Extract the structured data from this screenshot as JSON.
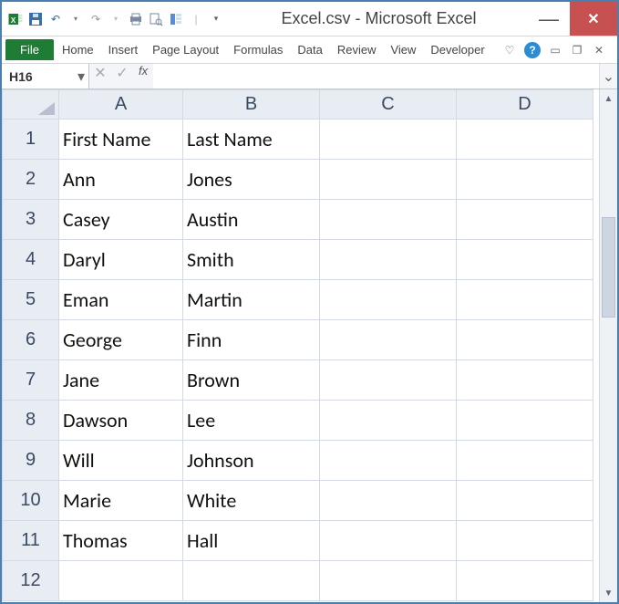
{
  "title": "Excel.csv - Microsoft Excel",
  "ribbon": {
    "file": "File",
    "tabs": [
      "Home",
      "Insert",
      "Page Layout",
      "Formulas",
      "Data",
      "Review",
      "View",
      "Developer"
    ]
  },
  "namebox": {
    "ref": "H16"
  },
  "formula": {
    "fx_label": "fx",
    "value": ""
  },
  "columns": [
    "A",
    "B",
    "C",
    "D"
  ],
  "rows": [
    "1",
    "2",
    "3",
    "4",
    "5",
    "6",
    "7",
    "8",
    "9",
    "10",
    "11",
    "12"
  ],
  "cells": {
    "r1": {
      "A": "First Name",
      "B": "Last Name"
    },
    "r2": {
      "A": "Ann",
      "B": "Jones"
    },
    "r3": {
      "A": "Casey",
      "B": "Austin"
    },
    "r4": {
      "A": "Daryl",
      "B": "Smith"
    },
    "r5": {
      "A": "Eman",
      "B": "Martin"
    },
    "r6": {
      "A": "George",
      "B": "Finn"
    },
    "r7": {
      "A": "Jane",
      "B": "Brown"
    },
    "r8": {
      "A": "Dawson",
      "B": "Lee"
    },
    "r9": {
      "A": "Will",
      "B": "Johnson"
    },
    "r10": {
      "A": "Marie",
      "B": "White"
    },
    "r11": {
      "A": "Thomas",
      "B": "Hall"
    },
    "r12": {
      "A": "",
      "B": ""
    }
  }
}
